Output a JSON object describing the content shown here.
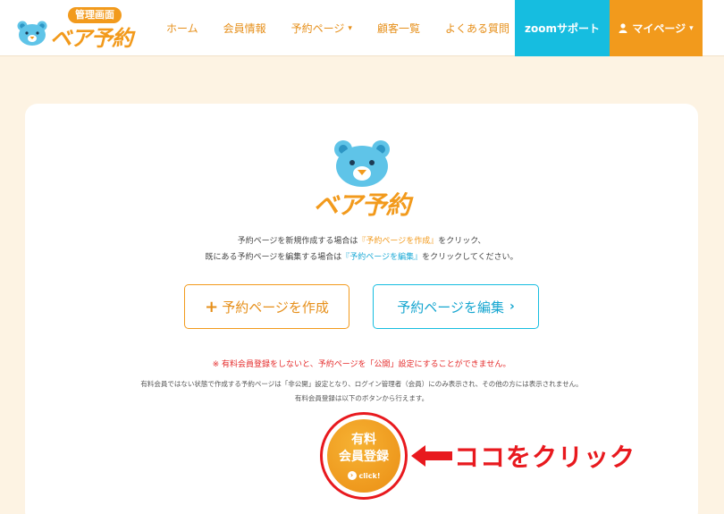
{
  "header": {
    "logo": {
      "badge": "管理画面",
      "text": "ベア予約"
    },
    "nav": [
      {
        "label": "ホーム",
        "caret": ""
      },
      {
        "label": "会員情報",
        "caret": ""
      },
      {
        "label": "予約ページ",
        "caret": "▾"
      },
      {
        "label": "顧客一覧",
        "caret": ""
      },
      {
        "label": "よくある質問",
        "caret": ""
      }
    ],
    "zoom_label": "zoomサポート",
    "mypage_label": "マイページ",
    "mypage_caret": "▾",
    "user_icon": "user-icon"
  },
  "main": {
    "brand": "ベア予約",
    "intro_1a": "予約ページを新規作成する場合は",
    "intro_1b": "『予約ページを作成』",
    "intro_1c": "をクリック、",
    "intro_2a": "既にある予約ページを編集する場合は",
    "intro_2b": "『予約ページを編集』",
    "intro_2c": "をクリックしてください。",
    "create_button": "予約ページを作成",
    "create_icon": "+",
    "edit_button": "予約ページを編集",
    "edit_icon": "›",
    "warning": "※ 有料会員登録をしないと、予約ページを「公開」設定にすることができません。",
    "note_1": "有料会員ではない状態で作成する予約ページは「非公開」設定となり、ログイン管理者（会員）にのみ表示され、その他の方には表示されません。",
    "note_2": "有料会員登録は以下のボタンから行えます。",
    "register": {
      "line1": "有料",
      "line2": "会員登録",
      "click": "click!",
      "click_icon": "›"
    },
    "annotation": "ココをクリック"
  },
  "colors": {
    "accent": "#f29a1c",
    "zoom": "#16bde0",
    "warning": "#e52b2b",
    "background": "#fdf3e3"
  }
}
